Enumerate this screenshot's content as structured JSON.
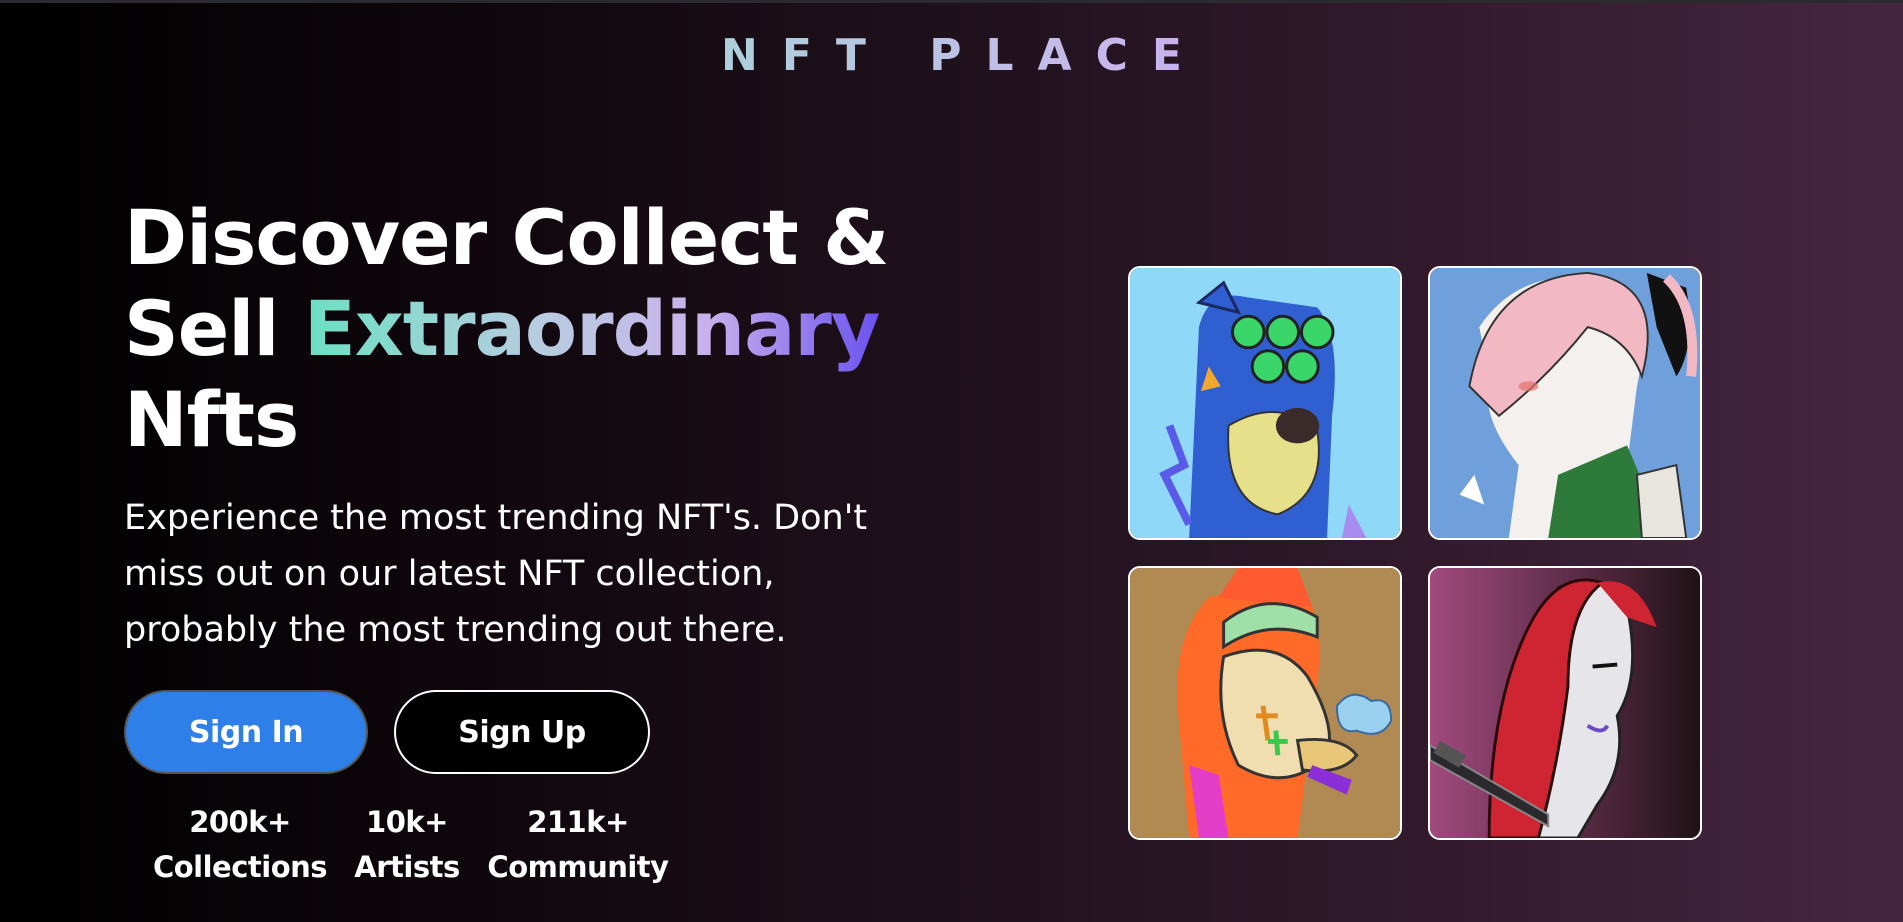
{
  "brand": {
    "logo": "NFT PLACE"
  },
  "hero": {
    "headline_line1": "Discover Collect &",
    "headline_sell": "Sell ",
    "headline_highlight": "Extraordinary",
    "headline_line3": "Nfts",
    "description": "Experience the most trending NFT's. Don't miss out on our latest NFT collection, probably the most trending out there."
  },
  "buttons": {
    "sign_in": "Sign In",
    "sign_up": "Sign Up"
  },
  "stats": [
    {
      "value": "200k+",
      "label": "Collections"
    },
    {
      "value": "10k+",
      "label": "Artists"
    },
    {
      "value": "211k+",
      "label": "Community"
    }
  ],
  "gallery": [
    {
      "name": "blue-bear-nft",
      "background": "#8fd8f8"
    },
    {
      "name": "pink-hair-anime-nft",
      "background": "#6fa0dc"
    },
    {
      "name": "orange-ape-nft",
      "background": "#b08a52"
    },
    {
      "name": "red-hair-samurai-nft",
      "background": "#a14a7e"
    }
  ],
  "colors": {
    "accent_teal": "#6be0c3",
    "accent_purple": "#6a52ee",
    "button_blue": "#2f7fe8"
  }
}
